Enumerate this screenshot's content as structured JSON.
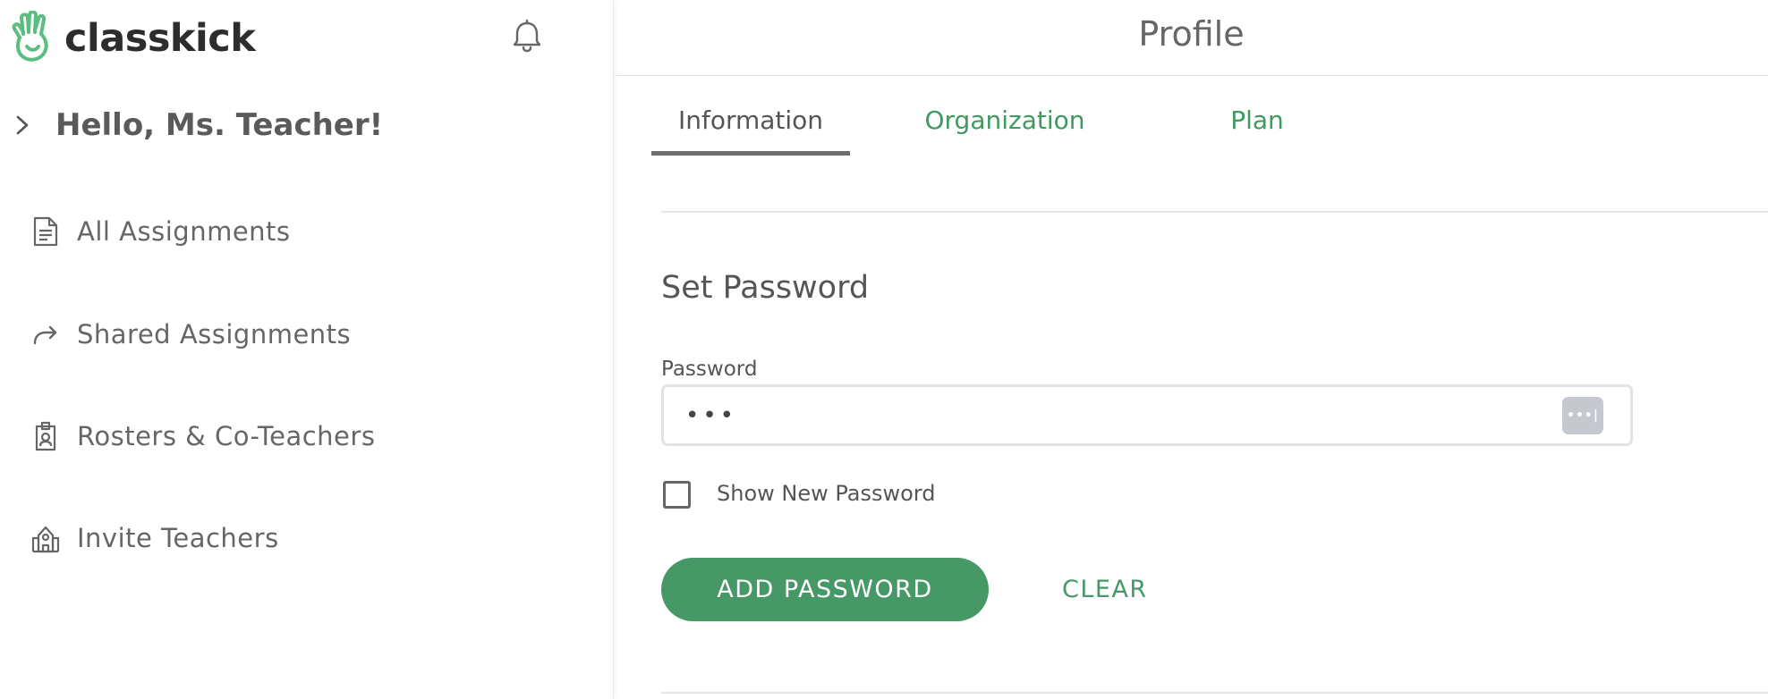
{
  "app": {
    "name": "classkick",
    "brand_color": "#5bbd7f",
    "accent_color": "#469966"
  },
  "header": {
    "title": "Profile",
    "bell_icon": "bell-icon"
  },
  "sidebar": {
    "greeting": "Hello, Ms. Teacher!",
    "items": [
      {
        "label": "All Assignments",
        "icon": "document-icon"
      },
      {
        "label": "Shared Assignments",
        "icon": "share-arrow-icon"
      },
      {
        "label": "Rosters & Co-Teachers",
        "icon": "badge-icon"
      },
      {
        "label": "Invite Teachers",
        "icon": "school-icon"
      }
    ]
  },
  "tabs": [
    {
      "label": "Information",
      "active": true
    },
    {
      "label": "Organization",
      "active": false
    },
    {
      "label": "Plan",
      "active": false
    }
  ],
  "form": {
    "section_title": "Set Password",
    "password_label": "Password",
    "password_value": "•••",
    "show_password_label": "Show New Password",
    "show_password_checked": false,
    "add_button": "ADD PASSWORD",
    "clear_button": "CLEAR"
  }
}
